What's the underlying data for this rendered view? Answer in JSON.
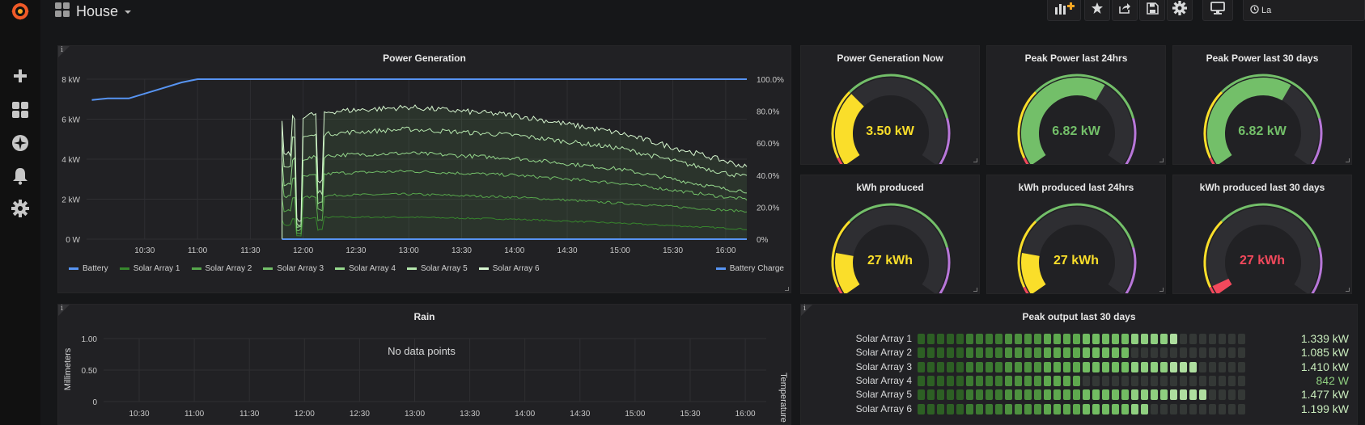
{
  "app": {
    "dashboard_title": "House",
    "cut_button_label": "La"
  },
  "colors": {
    "battery": "#5794f2",
    "green": "#73bf69",
    "yellow": "#fade2a",
    "red": "#f2495c",
    "purple": "#b877d9",
    "bg": "#161719",
    "panel": "#212124"
  },
  "sidebar": {
    "icons": [
      "grafana-logo-icon",
      "plus-icon",
      "dashboards-icon",
      "explore-icon",
      "bell-icon",
      "gear-icon"
    ]
  },
  "toolbar": {
    "icons": [
      "add-panel-icon",
      "star-icon",
      "share-icon",
      "save-icon",
      "settings-icon",
      "monitor-icon",
      "clock-icon"
    ]
  },
  "power_generation": {
    "title": "Power Generation",
    "legend": [
      "Battery",
      "Solar Array 1",
      "Solar Array 2",
      "Solar Array 3",
      "Solar Array 4",
      "Solar Array 5",
      "Solar Array 6"
    ],
    "right_legend": "Battery Charge"
  },
  "gauges": [
    {
      "title": "Power Generation Now",
      "value": "3.50 kW",
      "color": "#fade2a",
      "fraction": 0.32
    },
    {
      "title": "Peak Power last 24hrs",
      "value": "6.82 kW",
      "color": "#73bf69",
      "fraction": 0.62
    },
    {
      "title": "Peak Power last 30 days",
      "value": "6.82 kW",
      "color": "#73bf69",
      "fraction": 0.62
    },
    {
      "title": "kWh produced",
      "value": "27 kWh",
      "color": "#fade2a",
      "fraction": 0.18
    },
    {
      "title": "kWh produced last 24hrs",
      "value": "27 kWh",
      "color": "#fade2a",
      "fraction": 0.18
    },
    {
      "title": "kWh produced last 30 days",
      "value": "27 kWh",
      "color": "#f2495c",
      "fraction": 0.04
    }
  ],
  "rain": {
    "title": "Rain",
    "no_data": "No data points",
    "ylabel": "Millimeters",
    "y2label": "Temperature"
  },
  "peak_output": {
    "title": "Peak output last 30 days",
    "rows": [
      {
        "label": "Solar Array 1",
        "value": "1.339 kW",
        "fraction": 0.8
      },
      {
        "label": "Solar Array 2",
        "value": "1.085 kW",
        "fraction": 0.65
      },
      {
        "label": "Solar Array 3",
        "value": "1.410 kW",
        "fraction": 0.84
      },
      {
        "label": "Solar Array 4",
        "value": "842 W",
        "fraction": 0.5
      },
      {
        "label": "Solar Array 5",
        "value": "1.477 kW",
        "fraction": 0.88
      },
      {
        "label": "Solar Array 6",
        "value": "1.199 kW",
        "fraction": 0.72
      }
    ]
  },
  "chart_data": [
    {
      "type": "line",
      "title": "Power Generation",
      "x": [
        "10:30",
        "11:00",
        "11:30",
        "12:00",
        "12:30",
        "13:00",
        "13:30",
        "14:00",
        "14:30",
        "15:00",
        "15:30",
        "16:00"
      ],
      "y_ticks": [
        "0 W",
        "2 kW",
        "4 kW",
        "6 kW",
        "8 kW"
      ],
      "y2_ticks": [
        "0%",
        "20.0%",
        "40.0%",
        "60.0%",
        "80.0%",
        "100.0%"
      ],
      "ylim_kw": [
        0,
        8
      ],
      "series": [
        {
          "name": "Battery",
          "axis": "right",
          "unit": "%",
          "points": [
            [
              10.0,
              87
            ],
            [
              10.15,
              88
            ],
            [
              10.35,
              88
            ],
            [
              10.6,
              93
            ],
            [
              10.85,
              98
            ],
            [
              11.0,
              100
            ],
            [
              16.2,
              100
            ]
          ]
        },
        {
          "name": "Solar Array 1",
          "unit": "kW",
          "points": [
            [
              11.8,
              0.4
            ],
            [
              11.8,
              1.0
            ],
            [
              12.3,
              1.1
            ],
            [
              13.0,
              1.1
            ],
            [
              14.0,
              1.0
            ],
            [
              15.0,
              0.8
            ],
            [
              16.0,
              0.55
            ],
            [
              16.2,
              0.5
            ]
          ]
        },
        {
          "name": "Solar Array 2",
          "unit": "kW",
          "points": [
            [
              11.8,
              1.0
            ],
            [
              11.8,
              2.0
            ],
            [
              12.3,
              2.2
            ],
            [
              13.0,
              2.25
            ],
            [
              14.0,
              2.1
            ],
            [
              15.0,
              1.8
            ],
            [
              16.0,
              1.45
            ],
            [
              16.2,
              1.4
            ]
          ]
        },
        {
          "name": "Solar Array 3",
          "unit": "kW",
          "points": [
            [
              11.8,
              1.8
            ],
            [
              11.8,
              3.0
            ],
            [
              12.3,
              3.3
            ],
            [
              13.0,
              3.4
            ],
            [
              14.0,
              3.2
            ],
            [
              15.0,
              2.8
            ],
            [
              16.0,
              2.1
            ],
            [
              16.2,
              2.0
            ]
          ]
        },
        {
          "name": "Solar Array 4",
          "unit": "kW",
          "points": [
            [
              11.8,
              2.6
            ],
            [
              11.8,
              3.9
            ],
            [
              12.3,
              4.2
            ],
            [
              13.0,
              4.3
            ],
            [
              14.0,
              4.05
            ],
            [
              15.0,
              3.5
            ],
            [
              16.0,
              2.5
            ],
            [
              16.2,
              2.4
            ]
          ]
        },
        {
          "name": "Solar Array 5",
          "unit": "kW",
          "points": [
            [
              11.8,
              3.4
            ],
            [
              11.8,
              5.0
            ],
            [
              12.3,
              5.3
            ],
            [
              13.0,
              5.5
            ],
            [
              14.0,
              5.2
            ],
            [
              15.0,
              4.55
            ],
            [
              16.0,
              3.3
            ],
            [
              16.2,
              3.1
            ]
          ]
        },
        {
          "name": "Solar Array 6",
          "unit": "kW",
          "points": [
            [
              11.8,
              4.2
            ],
            [
              11.8,
              6.0
            ],
            [
              12.3,
              6.4
            ],
            [
              13.0,
              6.6
            ],
            [
              14.0,
              6.2
            ],
            [
              15.0,
              5.3
            ],
            [
              16.0,
              3.9
            ],
            [
              16.2,
              3.6
            ]
          ]
        }
      ]
    },
    {
      "type": "line",
      "title": "Rain",
      "x": [
        "10:30",
        "11:00",
        "11:30",
        "12:00",
        "12:30",
        "13:00",
        "13:30",
        "14:00",
        "14:30",
        "15:00",
        "15:30",
        "16:00"
      ],
      "y_ticks": [
        "0",
        "0.50",
        "1.00"
      ],
      "ylabel": "Millimeters",
      "y2label": "Temperature",
      "ylim": [
        0,
        1
      ],
      "series": []
    }
  ]
}
